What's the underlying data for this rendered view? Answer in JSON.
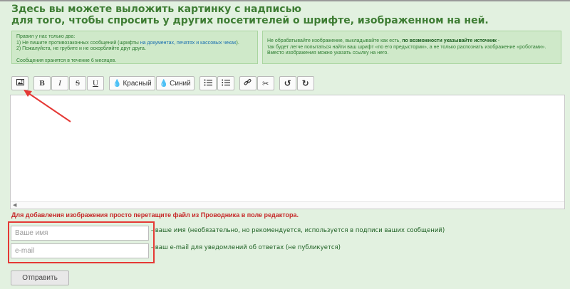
{
  "header": {
    "title_line1": "Здесь вы можете выложить картинку с надписью",
    "title_line2": "для того, чтобы спросить у других посетителей о шрифте, изображенном на ней."
  },
  "rules": {
    "intro": "Правил у нас только два:",
    "rule1_prefix": "1) Не пишите противозаконных сообщений (шрифты ",
    "rule1_link": "на документах, печатях и кассовых чеках",
    "rule1_suffix": ").",
    "rule2": "2) Пожалуйста, не грубите и не оскорбляйте друг друга.",
    "retention": "Сообщения хранятся в течение 6 месяцев."
  },
  "advice": {
    "line1_prefix": "Не обрабатывайте изображение, выкладывайте как есть, ",
    "line1_bold": "по возможности указывайте источник",
    "line1_suffix": " -",
    "line2": "так будет легче попытаться найти ваш шрифт «по его предыстории», а не только распознать изображение «роботами».",
    "line3": "Вместо изображения можно указать ссылку на него."
  },
  "toolbar": {
    "image_icon": "image-icon",
    "bold": "B",
    "italic": "I",
    "strike": "S",
    "underline": "U",
    "red_label": "Красный",
    "blue_label": "Синий",
    "bullet_icon": "bullet-list-icon",
    "numbered_icon": "numbered-list-icon",
    "link_icon": "link-icon",
    "unlink_icon": "scissors-icon",
    "undo_icon": "undo-icon",
    "redo_icon": "redo-icon"
  },
  "editor": {
    "drop_note": "Для добавления изображения просто перетащите файл из Проводника в поле редактора."
  },
  "form": {
    "name_placeholder": "Ваше имя",
    "name_hint": "- ваше имя (необязательно, но рекомендуется, используется в подписи ваших сообщений)",
    "email_placeholder": "e-mail",
    "email_hint": "- ваш e-mail для уведомлений об ответах (не публикуется)",
    "submit_label": "Отправить"
  },
  "colors": {
    "background": "#e2f1e0",
    "accent_green": "#3e7d34",
    "warning_red": "#c62828",
    "annotation_red": "#e53935"
  }
}
